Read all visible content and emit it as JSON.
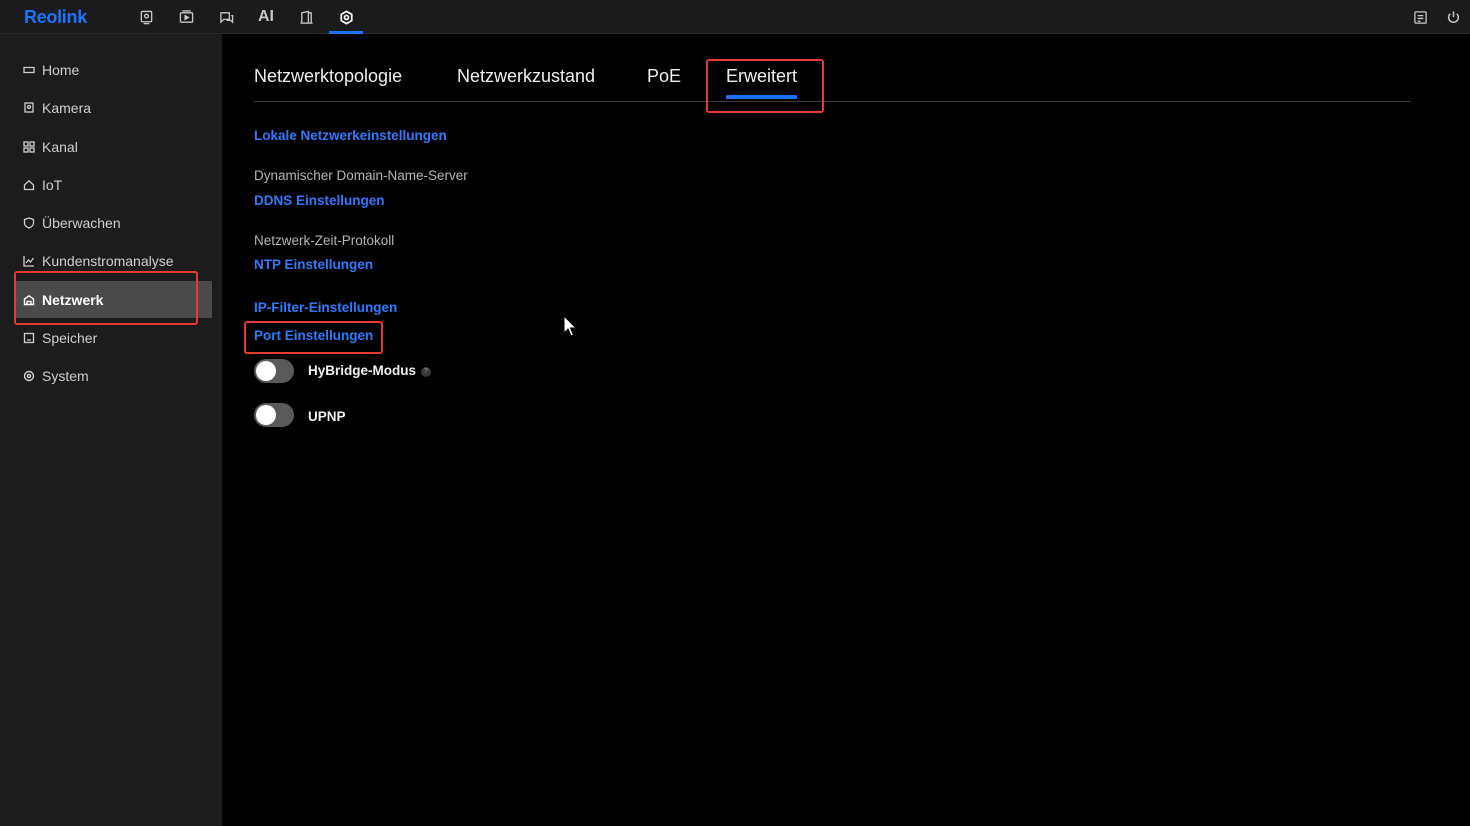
{
  "brand": {
    "name": "Reolink",
    "color": "#1a73ff"
  },
  "topbar": {
    "icons": [
      "camera-view-icon",
      "playback-icon",
      "chat-icon",
      "ai-label",
      "door-icon",
      "settings-icon"
    ],
    "ai_label": "AI",
    "right_icons": [
      "notes-icon",
      "power-icon"
    ]
  },
  "sidebar": {
    "items": [
      {
        "label": "Home",
        "icon": "home-icon"
      },
      {
        "label": "Kamera",
        "icon": "camera-icon"
      },
      {
        "label": "Kanal",
        "icon": "channel-grid-icon"
      },
      {
        "label": "IoT",
        "icon": "iot-home-icon"
      },
      {
        "label": "Überwachen",
        "icon": "shield-icon"
      },
      {
        "label": "Kundenstromanalyse",
        "icon": "chart-icon"
      },
      {
        "label": "Netzwerk",
        "icon": "network-icon",
        "active": true
      },
      {
        "label": "Speicher",
        "icon": "storage-icon"
      },
      {
        "label": "System",
        "icon": "system-gear-icon"
      }
    ]
  },
  "tabs": [
    {
      "label": "Netzwerktopologie"
    },
    {
      "label": "Netzwerkzustand"
    },
    {
      "label": "PoE"
    },
    {
      "label": "Erweitert",
      "active": true
    }
  ],
  "content": {
    "local_link": "Lokale Netzwerkeinstellungen",
    "ddns_label": "Dynamischer Domain-Name-Server",
    "ddns_link": "DDNS Einstellungen",
    "ntp_label": "Netzwerk-Zeit-Protokoll",
    "ntp_link": "NTP Einstellungen",
    "ipfilter_link": "IP-Filter-Einstellungen",
    "port_link": "Port Einstellungen",
    "hybridge_label": "HyBridge-Modus",
    "hybridge_help": "?",
    "hybridge_on": false,
    "upnp_label": "UPNP",
    "upnp_on": false
  },
  "colors": {
    "accent": "#1a73ff",
    "highlight": "#e63b32"
  }
}
